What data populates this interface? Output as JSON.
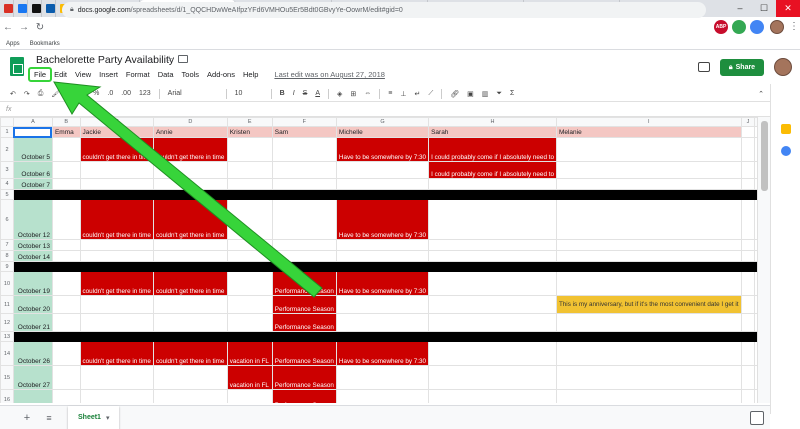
{
  "browser": {
    "tabs": [
      {
        "label": "",
        "fav": "#d93025",
        "w": 14,
        "icon": "gmail-icon"
      },
      {
        "label": "",
        "fav": "#1877f2",
        "w": 14,
        "icon": "facebook-icon"
      },
      {
        "label": "",
        "fav": "#111111",
        "w": 14,
        "icon": "app-icon"
      },
      {
        "label": "",
        "fav": "#0b5cad",
        "w": 14,
        "icon": "app-icon"
      },
      {
        "label": "My Drive - Google Drive",
        "fav": "#fbbc04",
        "w": 84,
        "icon": "drive-icon"
      },
      {
        "label": "Bachelorette Party Availab",
        "fav": "#0f9d58",
        "w": 96,
        "icon": "sheets-icon",
        "active": true
      },
      {
        "label": "How to convert Google",
        "fav": "#4285f4",
        "w": 96,
        "icon": "docs-icon"
      },
      {
        "label": "How to change your ad",
        "fav": "#222222",
        "w": 96,
        "icon": "bi-icon"
      },
      {
        "label": "FAQs: What is a mortgage",
        "fav": "#6b4fbb",
        "w": 96,
        "icon": "web-icon"
      },
      {
        "label": "Amazon.com: Amazon S",
        "fav": "#111111",
        "w": 96,
        "icon": "amazon-icon"
      }
    ],
    "url_host": "docs.google.com",
    "url_path": "/spreadsheets/d/1_QQCHDwWeAIfpzYFd6VMHOu5Er5Bdt0GBvyYe-OowrM/edit#gid=0",
    "bookmarks": [
      "Apps",
      "Bookmarks"
    ],
    "extensions": [
      {
        "label": "ABP",
        "color": "#c70d2c",
        "icon": "adblock-icon"
      },
      {
        "label": "",
        "color": "#34a853",
        "icon": "extension-icon"
      },
      {
        "label": "",
        "color": "#4285f4",
        "icon": "extension-icon"
      }
    ]
  },
  "doc": {
    "title": "Bachelorette Party Availability",
    "menus": [
      "File",
      "Edit",
      "View",
      "Insert",
      "Format",
      "Data",
      "Tools",
      "Add-ons",
      "Help"
    ],
    "last_edit": "Last edit was on August 27, 2018",
    "share_label": "Share"
  },
  "toolbar": {
    "zoom": "3",
    "percent": "%",
    "dec1": ".0",
    "dec2": ".00",
    "more_formats": "123",
    "font": "Arial",
    "font_size": "10",
    "bold": "B",
    "italic": "I",
    "strike": "S",
    "text_color": "A",
    "fx": "fx"
  },
  "grid": {
    "columns": [
      "A",
      "B",
      "C",
      "D",
      "E",
      "F",
      "G",
      "H",
      "I",
      "J",
      "K"
    ],
    "names": [
      "",
      "Emma",
      "Jackie",
      "Annie",
      "Kristen",
      "Sam",
      "Michelle",
      "Sarah",
      "Melanie",
      "",
      ""
    ],
    "rows": [
      {
        "n": "1",
        "header": true
      },
      {
        "n": "2",
        "date": "October 5",
        "cells": {
          "C": "couldn't get there in time",
          "D": "couldn't get there in time",
          "G": "Have to be somewhere by 7:30",
          "H": "I could probably come if I absolutely need to"
        }
      },
      {
        "n": "3",
        "date": "October 6",
        "cells": {
          "H": "I could probably come if I absolutely need to"
        }
      },
      {
        "n": "4",
        "date": "October 7",
        "cells": {}
      },
      {
        "n": "5",
        "black": true
      },
      {
        "n": "6",
        "date": "October 12",
        "tall": true,
        "cells": {
          "C": "couldn't get there in time",
          "D": "couldn't get there in time",
          "G": "Have to be somewhere by 7:30"
        }
      },
      {
        "n": "7",
        "date": "October 13",
        "cells": {}
      },
      {
        "n": "8",
        "date": "October 14",
        "cells": {}
      },
      {
        "n": "9",
        "black": true
      },
      {
        "n": "10",
        "date": "October 19",
        "cells": {
          "C": "couldn't get there in time",
          "D": "couldn't get there in time",
          "F": "Performance Season",
          "G": "Have to be somewhere by 7:30"
        }
      },
      {
        "n": "11",
        "date": "October 20",
        "cells": {
          "F": "Performance Season",
          "I": "This is my anniversary, but if it's the most convenient date I get it"
        }
      },
      {
        "n": "12",
        "date": "October 21",
        "cells": {
          "F": "Performance Season"
        }
      },
      {
        "n": "13",
        "black": true
      },
      {
        "n": "14",
        "date": "October 26",
        "cells": {
          "C": "couldn't get there in time",
          "D": "couldn't get there in time",
          "E": "vacation in FL",
          "F": "Performance Season",
          "G": "Have to be somewhere by 7:30"
        }
      },
      {
        "n": "15",
        "date": "October 27",
        "cells": {
          "E": "vacation in FL",
          "F": "Performance Season"
        }
      },
      {
        "n": "16",
        "date": "",
        "cells": {
          "F": "Performance Season"
        }
      }
    ]
  },
  "sheet_tab": "Sheet1",
  "highlight_color": "#37d43a"
}
